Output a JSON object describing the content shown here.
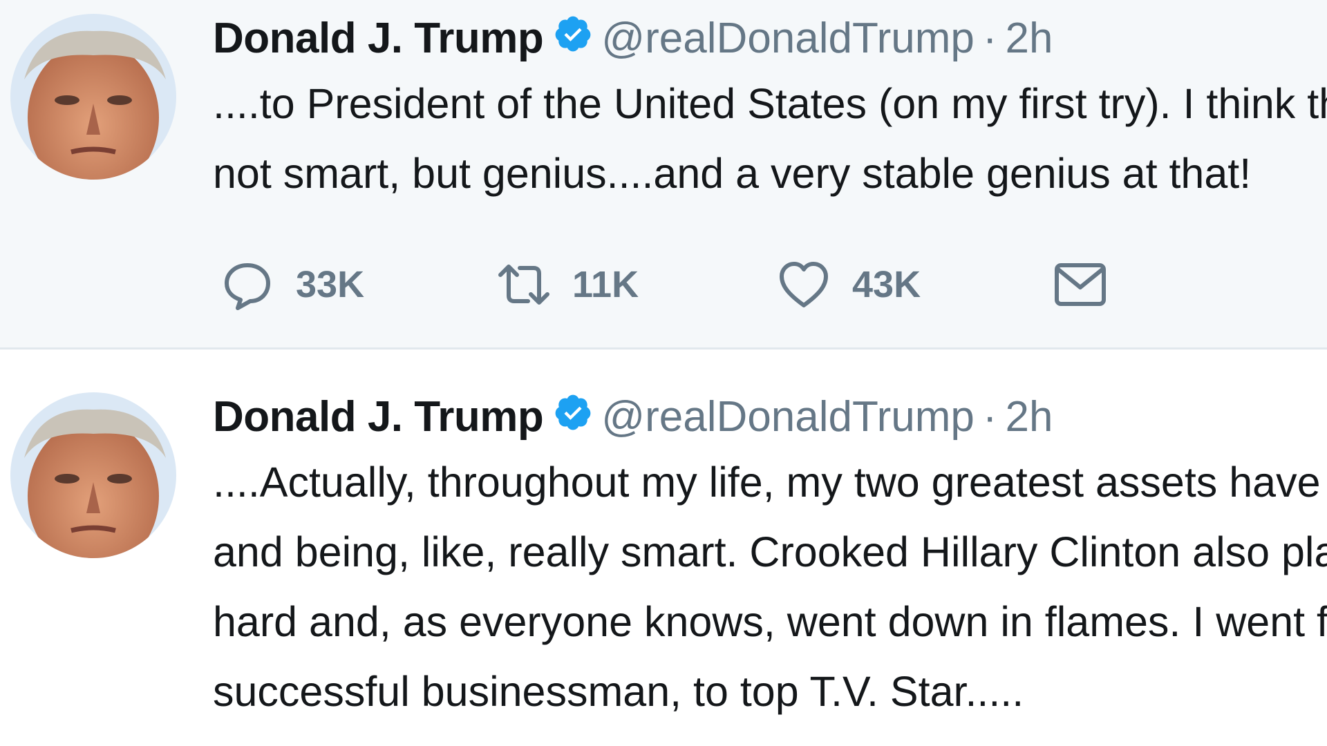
{
  "tweets": [
    {
      "author": {
        "name": "Donald J. Trump",
        "handle": "@realDonaldTrump",
        "verified": true
      },
      "separator": "·",
      "time": "2h",
      "lines": [
        "....to President of the United States (on my first try). I think that would qualify as",
        "not smart, but genius....and a very stable genius at that!"
      ],
      "actions": {
        "reply_count": "33K",
        "retweet_count": "11K",
        "like_count": "43K"
      }
    },
    {
      "author": {
        "name": "Donald J. Trump",
        "handle": "@realDonaldTrump",
        "verified": true
      },
      "separator": "·",
      "time": "2h",
      "lines": [
        "....Actually, throughout my life, my two greatest assets have been mental stability",
        "and being, like, really smart. Crooked Hillary Clinton also played these cards very",
        "hard and, as everyone knows, went down in flames. I went from VERY",
        "successful businessman, to top T.V. Star....."
      ]
    }
  ],
  "icons": {
    "verified": "verified-badge-icon",
    "reply": "reply-icon",
    "retweet": "retweet-icon",
    "like": "heart-icon",
    "dm": "envelope-icon"
  },
  "colors": {
    "verified": "#1da1f2",
    "muted": "#657786",
    "text": "#14171a",
    "highlight_bg": "#f5f8fa",
    "divider": "#e1e8ed"
  }
}
